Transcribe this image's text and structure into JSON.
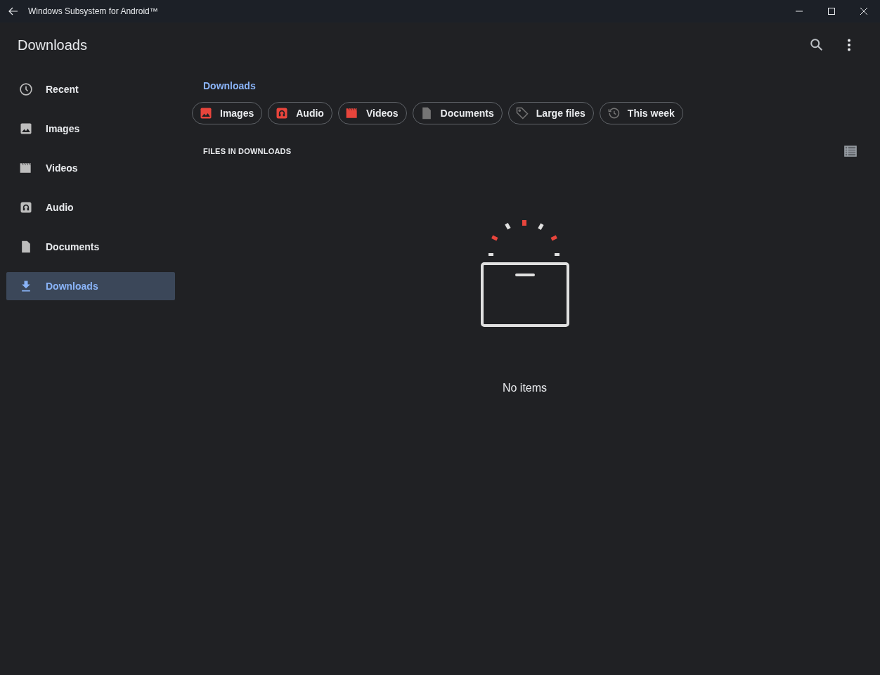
{
  "window": {
    "title": "Windows Subsystem for Android™"
  },
  "app_bar": {
    "title": "Downloads"
  },
  "sidebar": {
    "items": [
      {
        "kind": "recent",
        "label": "Recent",
        "selected": false
      },
      {
        "kind": "images",
        "label": "Images",
        "selected": false
      },
      {
        "kind": "videos",
        "label": "Videos",
        "selected": false
      },
      {
        "kind": "audio",
        "label": "Audio",
        "selected": false
      },
      {
        "kind": "documents",
        "label": "Documents",
        "selected": false
      },
      {
        "kind": "downloads",
        "label": "Downloads",
        "selected": true
      }
    ]
  },
  "breadcrumb": "Downloads",
  "chips": [
    {
      "kind": "images",
      "label": "Images",
      "color": "#e8453c"
    },
    {
      "kind": "audio",
      "label": "Audio",
      "color": "#e8453c"
    },
    {
      "kind": "videos",
      "label": "Videos",
      "color": "#e8453c"
    },
    {
      "kind": "documents",
      "label": "Documents",
      "color": "#757575"
    },
    {
      "kind": "large",
      "label": "Large files",
      "color": "#757575"
    },
    {
      "kind": "week",
      "label": "This week",
      "color": "#757575"
    }
  ],
  "section_title": "FILES IN DOWNLOADS",
  "empty_state": "No items"
}
